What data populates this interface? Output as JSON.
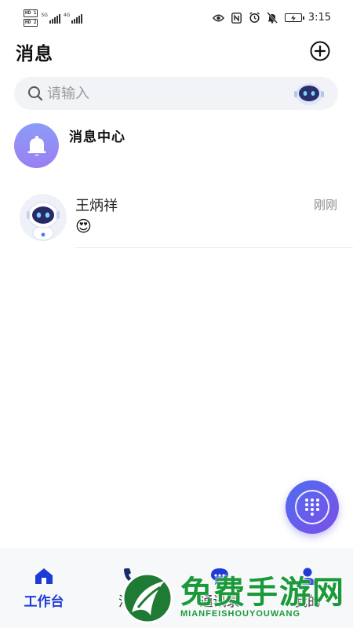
{
  "status_bar": {
    "left_badges": [
      "HD 1",
      "HD 2"
    ],
    "network_types": [
      "5G",
      "4G"
    ],
    "time": "3:15"
  },
  "header": {
    "title": "消息"
  },
  "search": {
    "placeholder": "请输入"
  },
  "message_center": {
    "title": "消息中心"
  },
  "chats": [
    {
      "name": "王炳祥",
      "time": "刚刚",
      "preview": "😍"
    }
  ],
  "tabs": [
    {
      "label": "工作台",
      "icon": "home-icon",
      "active": true
    },
    {
      "label": "消息",
      "icon": "phone-chat-icon",
      "active": false
    },
    {
      "label": "通讯录",
      "icon": "contacts-chat-icon",
      "active": false
    },
    {
      "label": "我的",
      "icon": "person-icon",
      "active": false
    }
  ],
  "watermark": {
    "text_cn": "免费手游网",
    "text_en": "MIANFEISHOUYOUWANG"
  },
  "colors": {
    "accent": "#1f3bd6",
    "fab_start": "#4f6cf0",
    "fab_end": "#7d4fe8",
    "bell_bg": "#8b9cf7",
    "watermark": "#1a9a3a"
  }
}
